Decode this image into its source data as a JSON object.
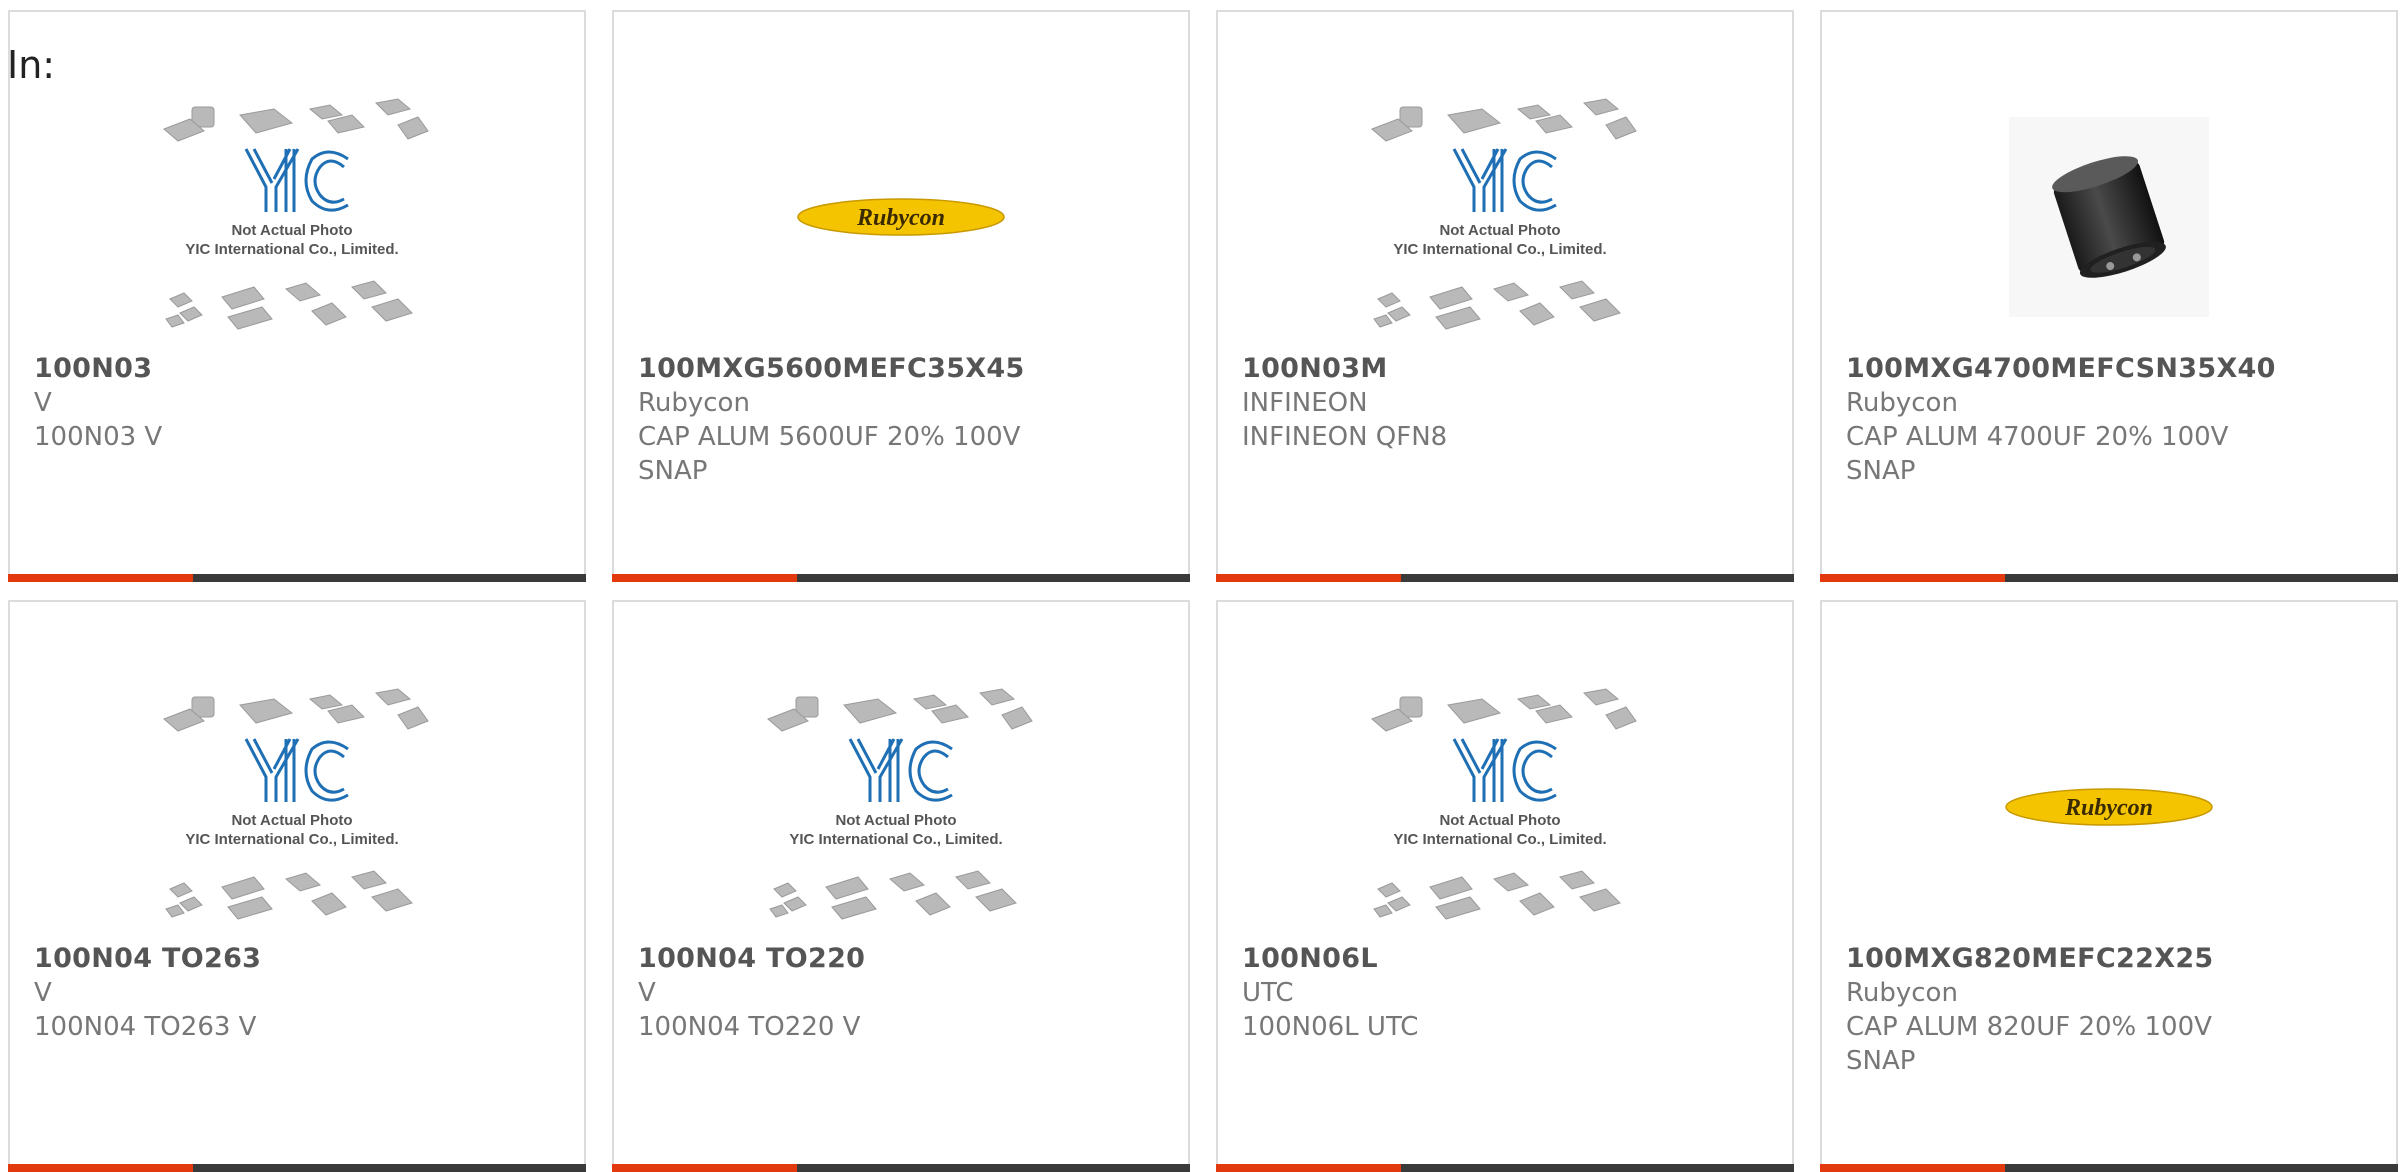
{
  "page": {
    "filter_label": "In:"
  },
  "colors": {
    "accent": "#e23a0e",
    "bar": "#3a3a3a",
    "yic_blue": "#1f6fb5",
    "rubycon_yellow": "#f5c400"
  },
  "products": [
    {
      "part_number": "100N03",
      "manufacturer": "V",
      "description": "100N03 V",
      "description2": "",
      "image": "yic-placeholder",
      "image_caption1": "Not Actual Photo",
      "image_caption2": "YIC International Co., Limited."
    },
    {
      "part_number": "100MXG5600MEFC35X45",
      "manufacturer": "Rubycon",
      "description": "CAP ALUM 5600UF 20% 100V",
      "description2": "SNAP",
      "image": "rubycon-logo",
      "logo_text": "Rubycon"
    },
    {
      "part_number": "100N03M",
      "manufacturer": "INFINEON",
      "description": "INFINEON QFN8",
      "description2": "",
      "image": "yic-placeholder",
      "image_caption1": "Not Actual Photo",
      "image_caption2": "YIC International Co., Limited."
    },
    {
      "part_number": "100MXG4700MEFCSN35X40",
      "manufacturer": "Rubycon",
      "description": "CAP ALUM 4700UF 20% 100V",
      "description2": "SNAP",
      "image": "capacitor-photo"
    },
    {
      "part_number": "100N04 TO263",
      "manufacturer": "V",
      "description": "100N04 TO263 V",
      "description2": "",
      "image": "yic-placeholder",
      "image_caption1": "Not Actual Photo",
      "image_caption2": "YIC International Co., Limited."
    },
    {
      "part_number": "100N04 TO220",
      "manufacturer": "V",
      "description": "100N04 TO220 V",
      "description2": "",
      "image": "yic-placeholder",
      "image_caption1": "Not Actual Photo",
      "image_caption2": "YIC International Co., Limited."
    },
    {
      "part_number": "100N06L",
      "manufacturer": "UTC",
      "description": "100N06L UTC",
      "description2": "",
      "image": "yic-placeholder",
      "image_caption1": "Not Actual Photo",
      "image_caption2": "YIC International Co., Limited."
    },
    {
      "part_number": "100MXG820MEFC22X25",
      "manufacturer": "Rubycon",
      "description": "CAP ALUM 820UF 20% 100V",
      "description2": "SNAP",
      "image": "rubycon-logo",
      "logo_text": "Rubycon"
    }
  ]
}
